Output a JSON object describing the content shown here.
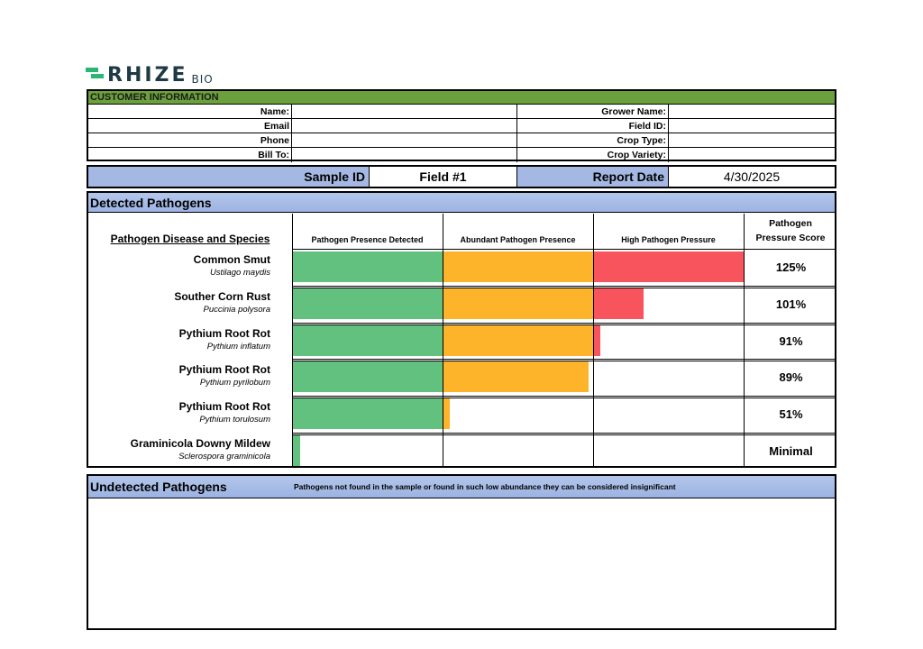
{
  "logo": {
    "main": "RHIZE",
    "sub": "BIO"
  },
  "customer": {
    "header": "CUSTOMER INFORMATION",
    "left_labels": [
      "Name:",
      "Email",
      "Phone",
      "Bill To:"
    ],
    "right_labels": [
      "Grower Name:",
      "Field ID:",
      "Crop Type:",
      "Crop Variety:"
    ]
  },
  "sample": {
    "id_label": "Sample ID",
    "id_value": "Field #1",
    "date_label": "Report Date",
    "date_value": "4/30/2025"
  },
  "detected": {
    "title": "Detected Pathogens",
    "col_species": "Pathogen Disease and Species",
    "col_detected": "Pathogen Presence Detected",
    "col_abundant": "Abundant Pathogen Presence",
    "col_high": "High Pathogen Pressure",
    "col_score": "Pathogen Pressure Score",
    "colors": {
      "green": "#62c17f",
      "orange": "#fdb42a",
      "red": "#f8545d"
    },
    "rows": [
      {
        "common": "Common Smut",
        "species": "Ustilago maydis",
        "score": "125%",
        "fill": [
          1.0,
          1.0,
          1.0
        ]
      },
      {
        "common": "Souther Corn Rust",
        "species": "Puccinia polysora",
        "score": "101%",
        "fill": [
          1.0,
          1.0,
          0.33
        ]
      },
      {
        "common": "Pythium Root Rot",
        "species": "Pythium inflatum",
        "score": "91%",
        "fill": [
          1.0,
          1.0,
          0.04
        ]
      },
      {
        "common": "Pythium Root Rot",
        "species": "Pythium pyrilobum",
        "score": "89%",
        "fill": [
          1.0,
          0.97,
          0
        ]
      },
      {
        "common": "Pythium Root Rot",
        "species": "Pythium torulosum",
        "score": "51%",
        "fill": [
          1.0,
          0.04,
          0
        ]
      },
      {
        "common": "Graminicola Downy Mildew",
        "species": "Sclerospora graminicola",
        "score": "Minimal",
        "fill": [
          0.05,
          0,
          0
        ]
      }
    ]
  },
  "undetected": {
    "title": "Undetected Pathogens",
    "note": "Pathogens not found in the sample or found in such low abundance they can be considered insignificant"
  }
}
